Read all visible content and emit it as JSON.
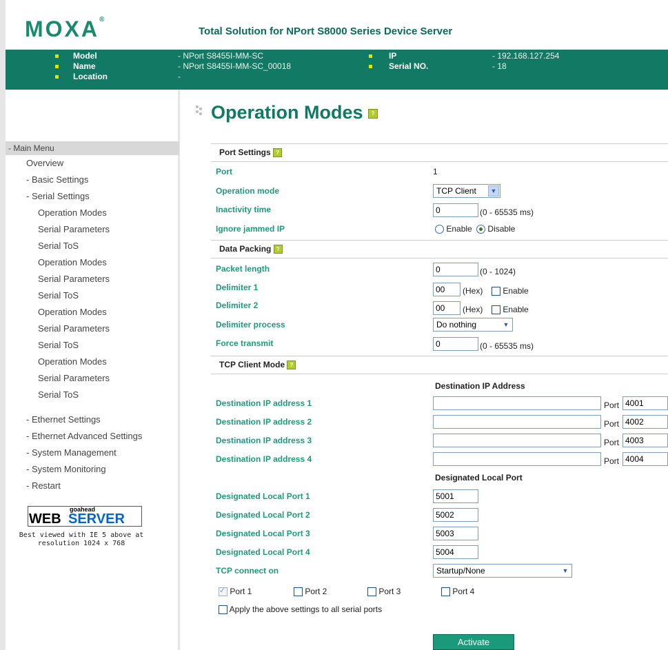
{
  "header": {
    "logo": "MOXA",
    "logo_reg": "®",
    "title": "Total Solution for NPort S8000 Series Device Server",
    "model_label": "Model",
    "model_value": "- NPort S8455I-MM-SC",
    "name_label": "Name",
    "name_value": "- NPort S8455I-MM-SC_00018",
    "location_label": "Location",
    "location_value": "-",
    "ip_label": "IP",
    "ip_value": "- 192.168.127.254",
    "serial_label": "Serial NO.",
    "serial_value": "- 18"
  },
  "sidebar": {
    "main_menu": "- Main Menu",
    "items": [
      "Overview",
      "- Basic Settings",
      "- Serial Settings",
      "Operation Modes",
      "Serial Parameters",
      "Serial ToS",
      "Operation Modes",
      "Serial Parameters",
      "Serial ToS",
      "Operation Modes",
      "Serial Parameters",
      "Serial ToS",
      "Operation Modes",
      "Serial Parameters",
      "Serial ToS",
      "- Ethernet Settings",
      "- Ethernet Advanced Settings",
      "- System Management",
      "- System Monitoring",
      "- Restart"
    ],
    "goahead": "goahead",
    "webserver_web": "WEB",
    "webserver_server": "SERVER",
    "best_viewed_1": "Best viewed with IE 5 above at",
    "best_viewed_2": "resolution 1024 x 768"
  },
  "page": {
    "title": "Operation Modes",
    "help": "?"
  },
  "port_settings": {
    "heading": "Port Settings",
    "port_label": "Port",
    "port_value": "1",
    "op_mode_label": "Operation mode",
    "op_mode_value": "TCP Client",
    "inactivity_label": "Inactivity time",
    "inactivity_value": "0",
    "inactivity_range": "(0 - 65535 ms)",
    "ignore_label": "Ignore jammed IP",
    "enable": "Enable",
    "disable": "Disable"
  },
  "data_packing": {
    "heading": "Data Packing",
    "packet_label": "Packet length",
    "packet_value": "0",
    "packet_range": "(0 - 1024)",
    "delim1_label": "Delimiter 1",
    "delim1_value": "00",
    "delim2_label": "Delimiter 2",
    "delim2_value": "00",
    "hex": "(Hex)",
    "enable": "Enable",
    "process_label": "Delimiter process",
    "process_value": "Do nothing",
    "force_label": "Force transmit",
    "force_value": "0",
    "force_range": "(0 - 65535 ms)"
  },
  "tcp_client": {
    "heading": "TCP Client Mode",
    "dest_heading": "Destination IP Address",
    "dest_labels": [
      "Destination IP address 1",
      "Destination IP address 2",
      "Destination IP address 3",
      "Destination IP address 4"
    ],
    "dest_values": [
      "",
      "",
      "",
      ""
    ],
    "port_word": "Port",
    "dest_ports": [
      "4001",
      "4002",
      "4003",
      "4004"
    ],
    "local_heading": "Designated Local Port",
    "local_labels": [
      "Designated Local Port 1",
      "Designated Local Port 2",
      "Designated Local Port 3",
      "Designated Local Port 4"
    ],
    "local_values": [
      "5001",
      "5002",
      "5003",
      "5004"
    ],
    "connect_label": "TCP connect on",
    "connect_value": "Startup/None",
    "ports": [
      "Port 1",
      "Port 2",
      "Port 3",
      "Port 4"
    ],
    "apply_all": "Apply the above settings to all serial ports",
    "activate": "Activate"
  }
}
